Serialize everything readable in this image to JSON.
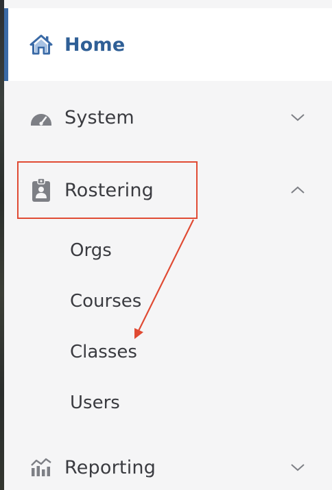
{
  "nav": {
    "home": {
      "label": "Home",
      "icon": "home-icon"
    },
    "system": {
      "label": "System",
      "icon": "gauge-icon",
      "expanded": false
    },
    "rostering": {
      "label": "Rostering",
      "icon": "clipboard-user-icon",
      "expanded": true,
      "children": [
        "Orgs",
        "Courses",
        "Classes",
        "Users"
      ]
    },
    "reporting": {
      "label": "Reporting",
      "icon": "bar-chart-icon",
      "expanded": false
    }
  },
  "colors": {
    "accent": "#2f5f96",
    "active_bar": "#3a6aa6",
    "annotation": "#e04a33",
    "icon_gray": "#7d7f85",
    "text": "#3a3b40"
  }
}
